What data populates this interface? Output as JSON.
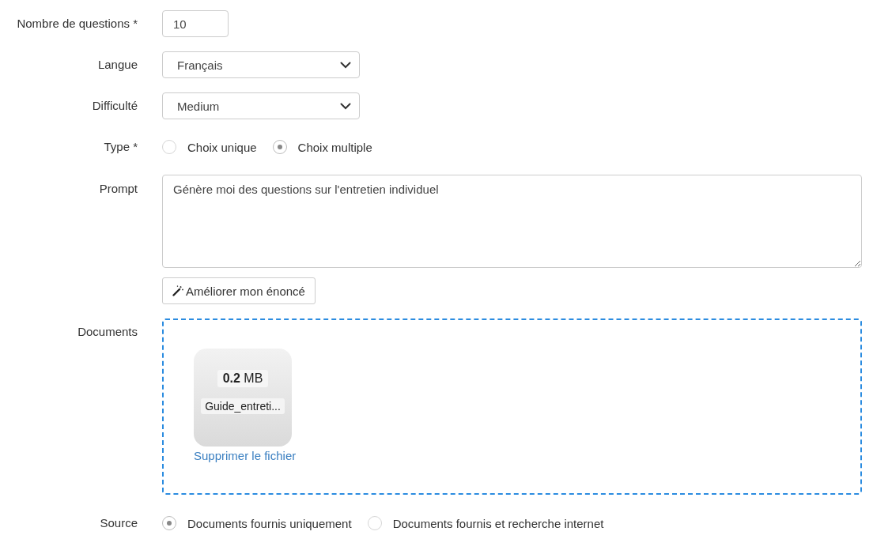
{
  "fields": [
    {
      "kind": "number",
      "label": "Nombre de questions *",
      "value": "10"
    },
    {
      "kind": "select",
      "label": "Langue",
      "value": "Français"
    },
    {
      "kind": "select",
      "label": "Difficulté",
      "value": "Medium"
    },
    {
      "kind": "radio",
      "label": "Type *",
      "options": [
        {
          "label": "Choix unique",
          "selected": false
        },
        {
          "label": "Choix multiple",
          "selected": true
        }
      ]
    },
    {
      "kind": "textarea",
      "label": "Prompt",
      "value": "Génère moi des questions sur l'entretien individuel",
      "button": "Améliorer mon énoncé"
    },
    {
      "kind": "files",
      "label": "Documents",
      "files": [
        {
          "size": "**0.2** MB",
          "name": "Guide_entreti...",
          "remove": "Supprimer le fichier"
        }
      ]
    },
    {
      "kind": "radio",
      "label": "Source",
      "options": [
        {
          "label": "Documents fournis uniquement",
          "selected": true
        },
        {
          "label": "Documents fournis et recherche internet",
          "selected": false
        }
      ]
    }
  ]
}
